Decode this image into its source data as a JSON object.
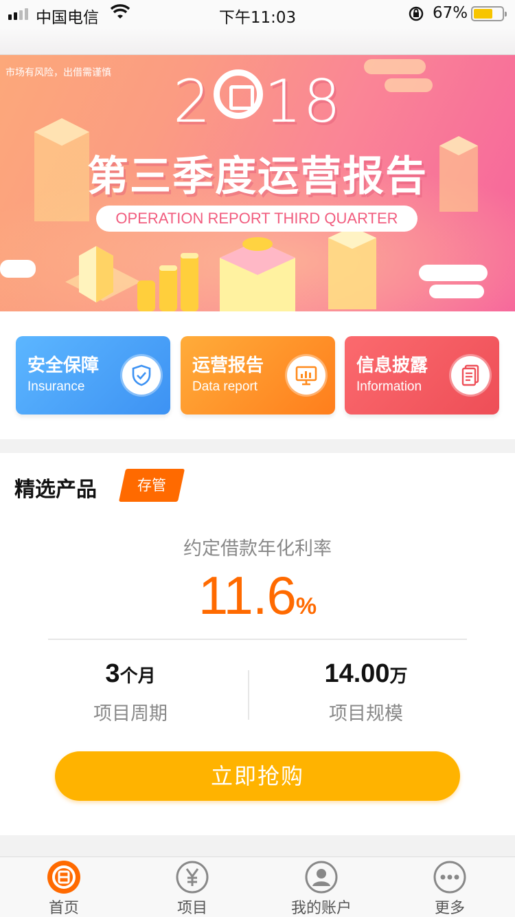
{
  "status_bar": {
    "carrier": "中国电信",
    "time": "下午11:03",
    "battery_percent": "67%",
    "battery_level": 0.67
  },
  "banner": {
    "risk_note": "市场有风险，出借需谨慎",
    "year_prefix": "2",
    "year_suffix": "18",
    "headline": "第三季度运营报告",
    "subhead": "OPERATION REPORT THIRD QUARTER"
  },
  "quick_links": [
    {
      "title": "安全保障",
      "subtitle": "Insurance",
      "icon": "shield-icon"
    },
    {
      "title": "运营报告",
      "subtitle": "Data report",
      "icon": "chart-screen-icon"
    },
    {
      "title": "信息披露",
      "subtitle": "Information",
      "icon": "document-icon"
    }
  ],
  "product": {
    "section_title": "精选产品",
    "badge": "存管",
    "rate_label": "约定借款年化利率",
    "rate_value": "11.6",
    "rate_unit": "%",
    "term_value": "3",
    "term_unit": "个月",
    "term_label": "项目周期",
    "scale_value": "14.00",
    "scale_unit": "万",
    "scale_label": "项目规模",
    "buy_label": "立即抢购"
  },
  "tabbar": {
    "tabs": [
      {
        "label": "首页",
        "icon": "home-logo-icon",
        "active": true
      },
      {
        "label": "项目",
        "icon": "yen-icon",
        "active": false
      },
      {
        "label": "我的账户",
        "icon": "user-icon",
        "active": false
      },
      {
        "label": "更多",
        "icon": "more-icon",
        "active": false
      }
    ]
  },
  "colors": {
    "accent_orange": "#ff6a00",
    "buy_yellow": "#ffb300",
    "insurance_blue": "#3d92f3",
    "report_orange": "#ff7e1c",
    "info_red": "#ee4e57"
  }
}
